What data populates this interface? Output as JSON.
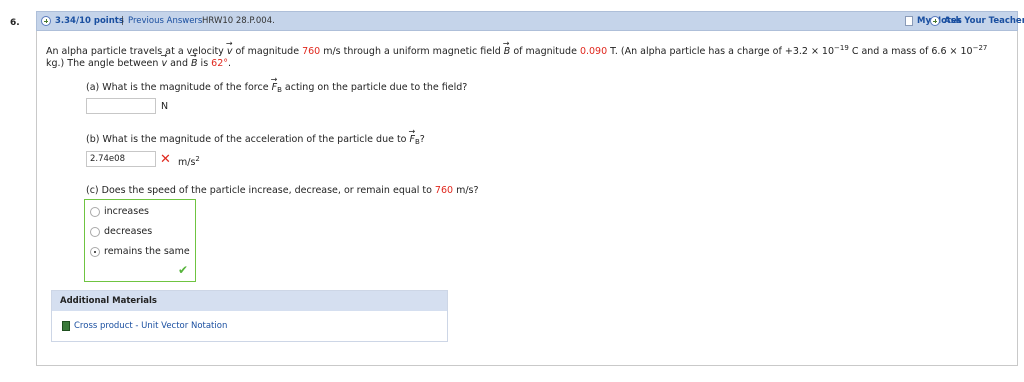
{
  "question": {
    "number": "6.",
    "points": "3.34/10 points",
    "separator": "|",
    "previous_answers": "Previous Answers",
    "problem_id": "HRW10 28.P.004.",
    "my_notes": "My Notes",
    "ask_teacher": "Ask Your Teacher"
  },
  "body": {
    "line1_a": "An alpha particle travels at a velocity ",
    "sym_v": "v",
    "line1_b": " of magnitude ",
    "velocity": "760",
    "line1_c": " m/s through a uniform magnetic field ",
    "sym_B": "B",
    "line1_d": " of magnitude ",
    "field": "0.090",
    "line1_e": " T. (An alpha particle has a charge of +3.2 × 10",
    "charge_exp": "−19",
    "line1_f": " C and a mass of 6.6 × 10",
    "mass_exp": "−27",
    "line2_a": "kg.) The angle between ",
    "line2_b": " and ",
    "line2_c": " is ",
    "angle": "62°",
    "line2_d": "."
  },
  "part_a": {
    "q_a": "(a) What is the magnitude of the force ",
    "sym_F": "F",
    "sub_B": "B",
    "q_b": " acting on the particle due to the field?",
    "value": "",
    "unit": "N"
  },
  "part_b": {
    "q_a": "(b) What is the magnitude of the acceleration of the particle due to ",
    "sym_F": "F",
    "sub_B": "B",
    "q_b": "?",
    "value": "2.74e08",
    "status_icon": "x-icon",
    "unit": "m/s",
    "unit_exp": "2"
  },
  "part_c": {
    "q_a": "(c) Does the speed of the particle increase, decrease, or remain equal to ",
    "velocity": "760",
    "q_b": " m/s?",
    "options": [
      "increases",
      "decreases",
      "remains the same"
    ],
    "selected": "remains the same",
    "status_icon": "check-icon"
  },
  "additional": {
    "title": "Additional Materials",
    "link": "Cross product - Unit Vector Notation"
  },
  "colors": {
    "header_bg": "#c5d4ea",
    "link_blue": "#1a4fa0",
    "value_red": "#e0281e",
    "correct_green": "#56b33a"
  }
}
